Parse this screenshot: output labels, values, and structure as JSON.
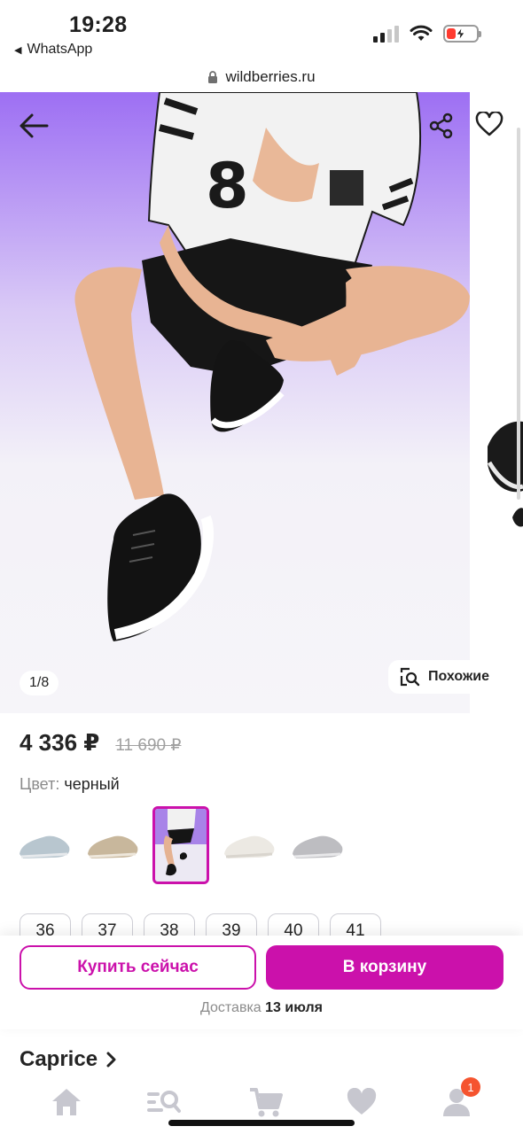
{
  "status_bar": {
    "time": "19:28",
    "back_app": "WhatsApp",
    "back_icon": "back-triangle-icon"
  },
  "url_bar": {
    "domain": "wildberries.ru",
    "lock_icon": "lock-icon"
  },
  "gallery": {
    "counter": "1/8",
    "similar_label": "Похожие",
    "icons": {
      "back": "arrow-left-icon",
      "share": "share-icon",
      "favorite": "heart-icon",
      "similar": "visual-search-icon"
    }
  },
  "product": {
    "price": "4 336 ₽",
    "old_price": "11 690 ₽",
    "color_label": "Цвет:",
    "color_value": "черный",
    "swatch_colors": [
      "light-blue",
      "beige",
      "black",
      "white",
      "grey"
    ],
    "selected_swatch": 2,
    "sizes": [
      "36",
      "37",
      "38",
      "39",
      "40",
      "41"
    ]
  },
  "actions": {
    "buy_now": "Купить сейчас",
    "add_to_cart": "В корзину",
    "delivery_label": "Доставка",
    "delivery_date": "13 июля"
  },
  "brand": {
    "name": "Caprice"
  },
  "tab_bar": {
    "items": [
      "home-icon",
      "catalog-search-icon",
      "cart-icon",
      "favorites-icon",
      "profile-icon"
    ],
    "profile_badge": "1"
  },
  "colors": {
    "accent": "#cb11ab",
    "badge": "#f5542f"
  }
}
